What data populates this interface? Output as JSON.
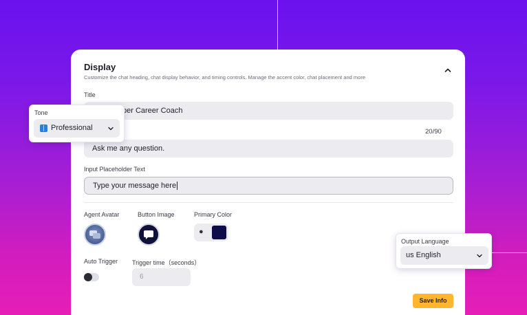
{
  "panel": {
    "title": "Display",
    "subtitle": "Customize the chat heading, chat display behavior, and timing controls. Manage the accent color, chat placement and more"
  },
  "fields": {
    "title_label": "Title",
    "title_value": "per Career Coach",
    "welcome_value": "Ask me any question.",
    "welcome_counter": "20/90",
    "placeholder_label": "Input Placeholder Text",
    "placeholder_value": "Type your message here"
  },
  "media": {
    "agent_avatar_label": "Agent Avatar",
    "button_image_label": "Button Image",
    "primary_color_label": "Primary Color",
    "primary_color": "#0e0d4a",
    "palette_icon": "palette-icon"
  },
  "trigger": {
    "auto_trigger_label": "Auto Trigger",
    "auto_trigger_on": false,
    "trigger_time_label": "Trigger time（seconds）",
    "trigger_time_value": "6"
  },
  "actions": {
    "save_label": "Save Info"
  },
  "tone": {
    "label": "Tone",
    "value": "Professional",
    "icon": "book-icon"
  },
  "language": {
    "label": "Output Language",
    "value": "us English"
  },
  "colors": {
    "accent": "#ffb52e",
    "background_top": "#6a12ee",
    "background_bottom": "#e61eb7"
  }
}
